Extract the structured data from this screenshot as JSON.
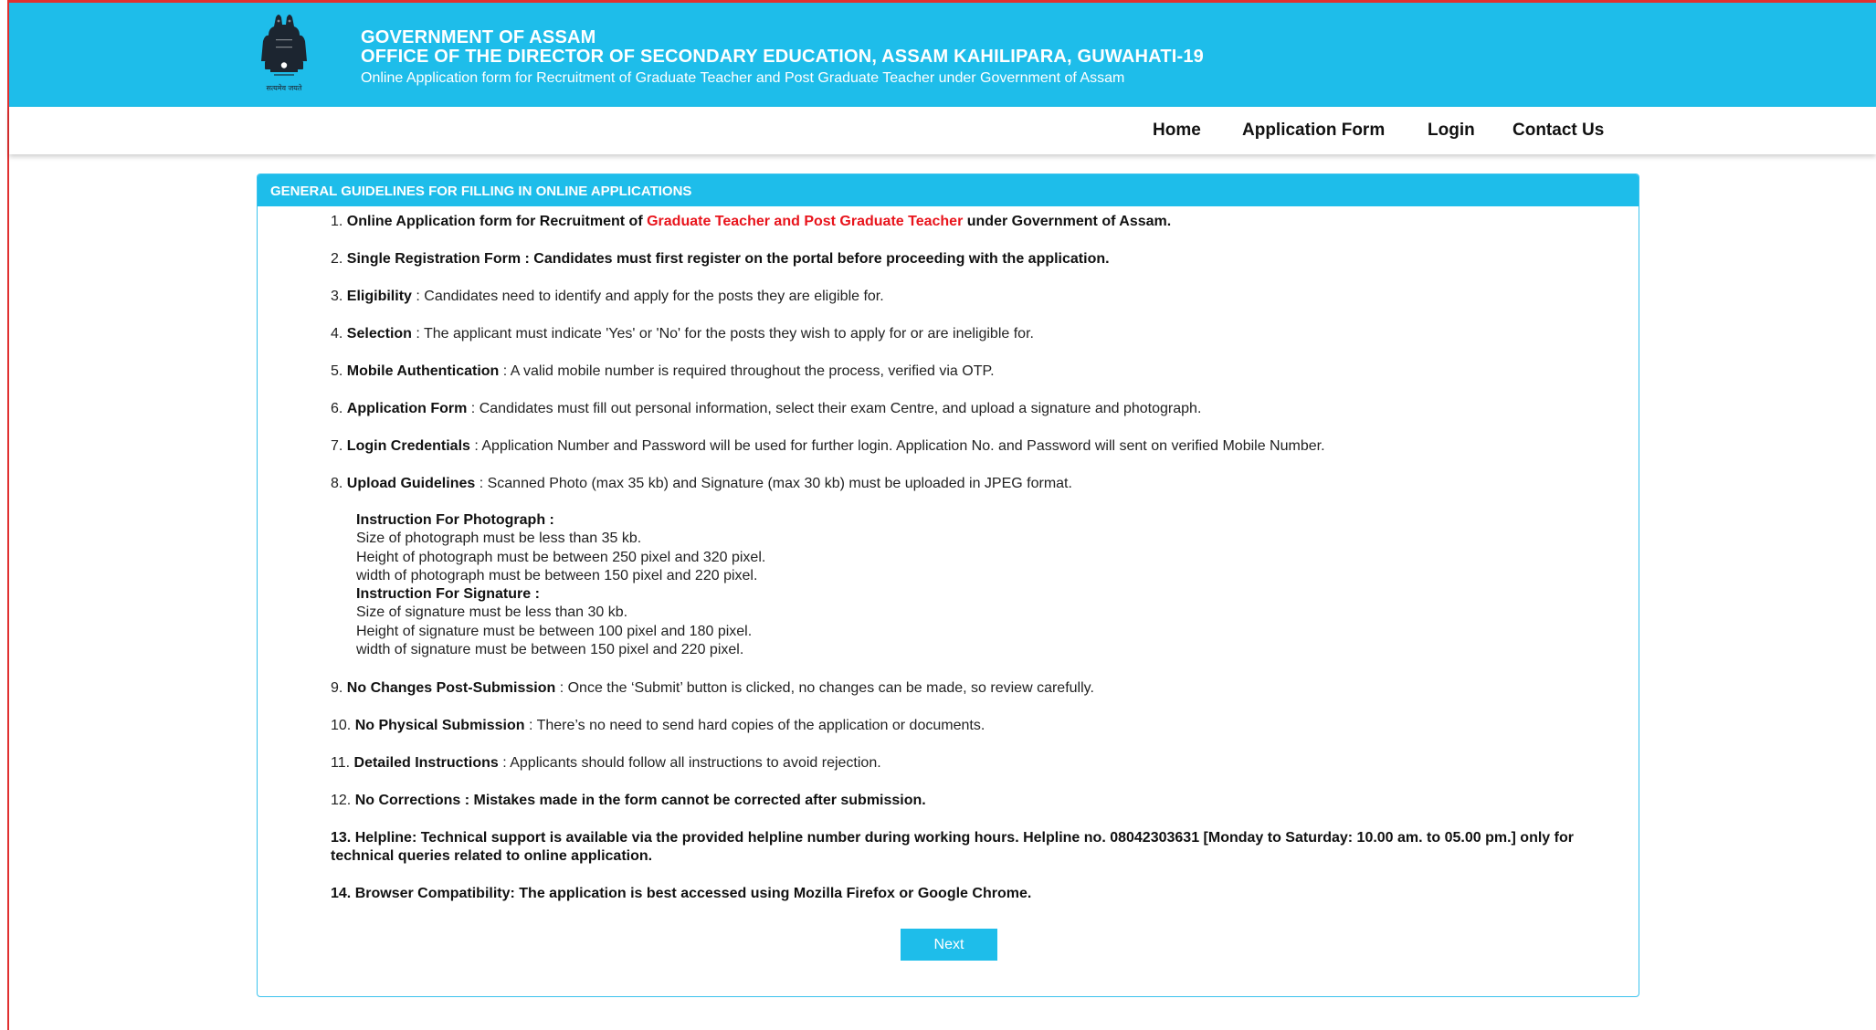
{
  "header": {
    "line1": "GOVERNMENT OF ASSAM",
    "line2": "OFFICE OF THE DIRECTOR OF SECONDARY EDUCATION, ASSAM KAHILIPARA, GUWAHATI-19",
    "line3": "Online Application form for Recruitment of Graduate Teacher and Post Graduate Teacher under Government of Assam",
    "emblem_caption": "सत्यमेव जयते"
  },
  "nav": {
    "home": "Home",
    "application_form": "Application Form",
    "login": "Login",
    "contact_us": "Contact Us"
  },
  "panel": {
    "title": "GENERAL GUIDELINES FOR FILLING IN ONLINE APPLICATIONS"
  },
  "guidelines": {
    "g1": {
      "num": "1.",
      "pre": "Online Application form for Recruitment of ",
      "highlight": "Graduate Teacher and Post Graduate Teacher",
      "post": " under Government of Assam."
    },
    "g2": {
      "num": "2.",
      "text": "Single Registration Form : Candidates must first register on the portal before proceeding with the application."
    },
    "g3": {
      "num": "3.",
      "label": "Eligibility",
      "text": " : Candidates need to identify and apply for the posts they are eligible for."
    },
    "g4": {
      "num": "4.",
      "label": "Selection",
      "text": " : The applicant must indicate 'Yes' or 'No' for the posts they wish to apply for or are ineligible for."
    },
    "g5": {
      "num": "5.",
      "label": "Mobile Authentication",
      "text": " : A valid mobile number is required throughout the process, verified via OTP."
    },
    "g6": {
      "num": "6.",
      "label": "Application Form",
      "text": " : Candidates must fill out personal information, select their exam Centre, and upload a signature and photograph."
    },
    "g7": {
      "num": "7.",
      "label": "Login Credentials",
      "text": " : Application Number and Password will be used for further login. Application No. and Password will sent on verified Mobile Number."
    },
    "g8": {
      "num": "8.",
      "label": "Upload Guidelines",
      "text": " : Scanned Photo (max 35 kb) and Signature (max 30 kb) must be uploaded in JPEG format."
    },
    "photo": {
      "heading": "Instruction For Photograph :",
      "l1": "Size of photograph must be less than 35 kb.",
      "l2": "Height of photograph must be between 250 pixel and 320 pixel.",
      "l3": "width of photograph must be between 150 pixel and 220 pixel."
    },
    "signature": {
      "heading": "Instruction For Signature :",
      "l1": "Size of signature must be less than 30 kb.",
      "l2": "Height of signature must be between 100 pixel and 180 pixel.",
      "l3": "width of signature must be between 150 pixel and 220 pixel."
    },
    "g9": {
      "num": "9.",
      "label": "No Changes Post-Submission",
      "text": " : Once the ‘Submit’ button is clicked, no changes can be made, so review carefully."
    },
    "g10": {
      "num": "10.",
      "label": "No Physical Submission",
      "text": " : There’s no need to send hard copies of the application or documents."
    },
    "g11": {
      "num": "11.",
      "label": "Detailed Instructions",
      "text": " : Applicants should follow all instructions to avoid rejection."
    },
    "g12": {
      "num": "12.",
      "text": "No Corrections : Mistakes made in the form cannot be corrected after submission."
    },
    "g13": {
      "num": "13.",
      "text": "Helpline: Technical support is available via the provided helpline number during working hours. Helpline no. 08042303631 [Monday to Saturday: 10.00 am. to 05.00 pm.] only for technical queries related to online application."
    },
    "g14": {
      "num": "14.",
      "text": "Browser Compatibility: The application is best accessed using Mozilla Firefox or Google Chrome."
    }
  },
  "next_button": "Next",
  "colors": {
    "brand": "#1ebdea",
    "highlight": "#e8141c",
    "frame": "#e03030"
  }
}
